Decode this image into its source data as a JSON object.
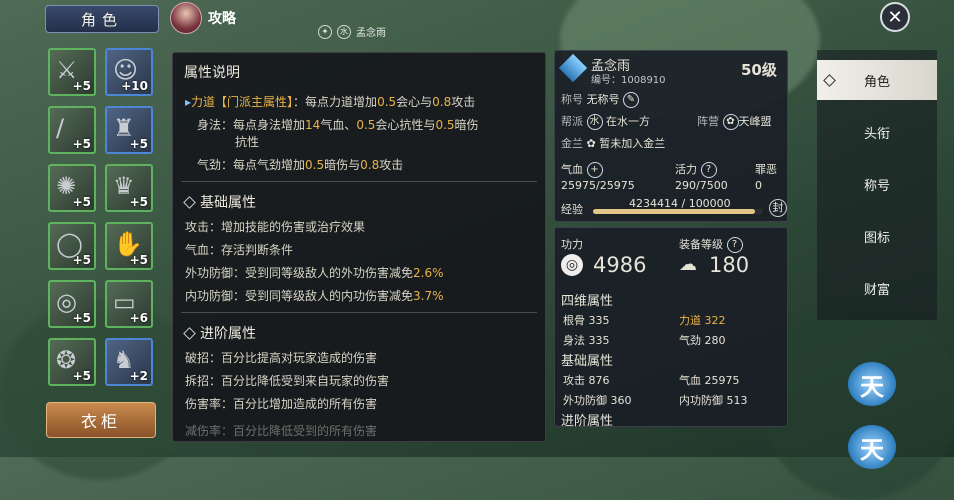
{
  "header": {
    "role_tab": "角色",
    "guide_label": "攻略",
    "player_name": "孟念雨"
  },
  "equipment": {
    "slots": [
      {
        "icon": "sword-icon",
        "level": "+5",
        "rarity": "green"
      },
      {
        "icon": "portrait",
        "level": "+10",
        "rarity": "blue"
      },
      {
        "icon": "rod-icon",
        "level": "+5",
        "rarity": "green"
      },
      {
        "icon": "robe-icon",
        "level": "+5",
        "rarity": "blue"
      },
      {
        "icon": "orb-icon",
        "level": "+5",
        "rarity": "green"
      },
      {
        "icon": "armor-icon",
        "level": "+5",
        "rarity": "green"
      },
      {
        "icon": "ring-icon",
        "level": "+5",
        "rarity": "green"
      },
      {
        "icon": "gauntlet-icon",
        "level": "+5",
        "rarity": "green"
      },
      {
        "icon": "bracelet-icon",
        "level": "+5",
        "rarity": "green"
      },
      {
        "icon": "belt-icon",
        "level": "+6",
        "rarity": "green"
      },
      {
        "icon": "pendant-icon",
        "level": "+5",
        "rarity": "green"
      },
      {
        "icon": "boots-icon",
        "level": "+2",
        "rarity": "blue"
      }
    ],
    "wardrobe_label": "衣柜"
  },
  "attr_panel": {
    "title": "属性说明",
    "primary": [
      {
        "key": "力道【门派主属性】",
        "text": "：每点力道增加",
        "v1": "0.5",
        "m1": "会心与",
        "v2": "0.8",
        "m2": "攻击"
      },
      {
        "key": "身法",
        "text": "：每点身法增加",
        "v1": "14",
        "m1": "气血、",
        "v2": "0.5",
        "m2": "会心抗性与",
        "v3": "0.5",
        "m3": "暗伤",
        "line2": "抗性"
      },
      {
        "key": "气劲",
        "text": "：每点气劲增加",
        "v1": "0.5",
        "m1": "暗伤与",
        "v2": "0.8",
        "m2": "攻击"
      }
    ],
    "basic": {
      "title": "基础属性",
      "rows": [
        {
          "key": "攻击",
          "text": "：增加技能的伤害或治疗效果"
        },
        {
          "key": "气血",
          "text": "：存活判断条件"
        },
        {
          "key": "外功防御",
          "text": "：受到同等级敌人的外功伤害减免",
          "val": "2.6%"
        },
        {
          "key": "内功防御",
          "text": "：受到同等级敌人的内功伤害减免",
          "val": "3.7%"
        }
      ]
    },
    "advanced": {
      "title": "进阶属性",
      "rows": [
        {
          "key": "破招",
          "text": "：百分比提高对玩家造成的伤害"
        },
        {
          "key": "拆招",
          "text": "：百分比降低受到来自玩家的伤害"
        },
        {
          "key": "伤害率",
          "text": "：百分比增加造成的所有伤害"
        },
        {
          "key": "减伤率",
          "text": "：百分比降低受到的所有伤害"
        }
      ]
    }
  },
  "profile": {
    "name": "孟念雨",
    "id_label": "编号：",
    "id": "1008910",
    "level": "50级",
    "title_label": "称号",
    "title_value": "无称号",
    "sect_label": "帮派",
    "sect_value": "在水一方",
    "faction_label": "阵营",
    "faction_value": "天峰盟",
    "gold_label": "金兰",
    "gold_value": "暂未加入金兰",
    "hp_label": "气血",
    "hp_value": "25975/25975",
    "vitality_label": "活力",
    "vitality_value": "290/7500",
    "sin_label": "罪恶",
    "sin_value": "0",
    "exp_label": "经验",
    "exp_value": "4234414 / 100000",
    "exp_fill": 0.95,
    "seal_label": "封"
  },
  "power": {
    "power_label": "功力",
    "power_value": "4986",
    "gear_label": "装备等级",
    "gear_value": "180"
  },
  "four_dim": {
    "title": "四维属性",
    "items": [
      {
        "label": "根骨",
        "value": "335",
        "color": "normal"
      },
      {
        "label": "力道",
        "value": "322",
        "color": "gold"
      },
      {
        "label": "身法",
        "value": "335",
        "color": "normal"
      },
      {
        "label": "气劲",
        "value": "280",
        "color": "normal"
      }
    ]
  },
  "basic_stats": {
    "title": "基础属性",
    "items": [
      {
        "label": "攻击",
        "value": "876"
      },
      {
        "label": "气血",
        "value": "25975"
      },
      {
        "label": "外功防御",
        "value": "360"
      },
      {
        "label": "内功防御",
        "value": "513"
      }
    ]
  },
  "adv_title": "进阶属性",
  "sidebar": {
    "items": [
      "角色",
      "头衔",
      "称号",
      "图标",
      "财富"
    ]
  },
  "heaven_glyph": "天"
}
